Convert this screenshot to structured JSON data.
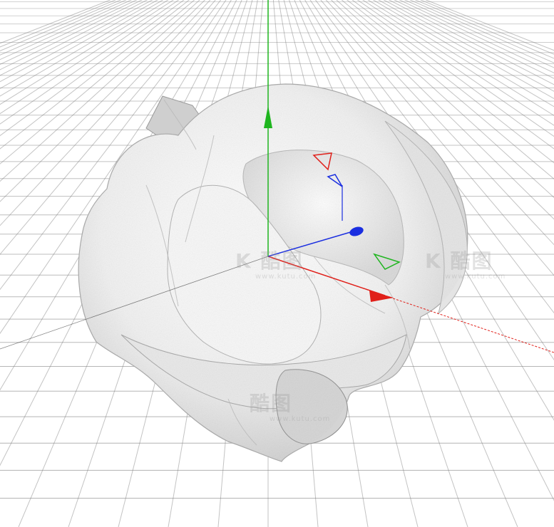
{
  "viewport": {
    "background": "#ffffff",
    "grid_color": "#7a7a7a",
    "axes": {
      "x_color": "#e0201a",
      "y_color": "#1fb51f",
      "z_color": "#1a2ee0"
    },
    "object": {
      "kind": "rough organic sculpted mesh",
      "shading_color": "#f2f2f2"
    }
  },
  "watermarks": [
    {
      "text": "K 酷图",
      "sub": "www.kutu.com"
    },
    {
      "text": "K 酷图",
      "sub": "www.kutu.com"
    },
    {
      "text": "酷图",
      "sub": "www.kutu.com"
    }
  ]
}
